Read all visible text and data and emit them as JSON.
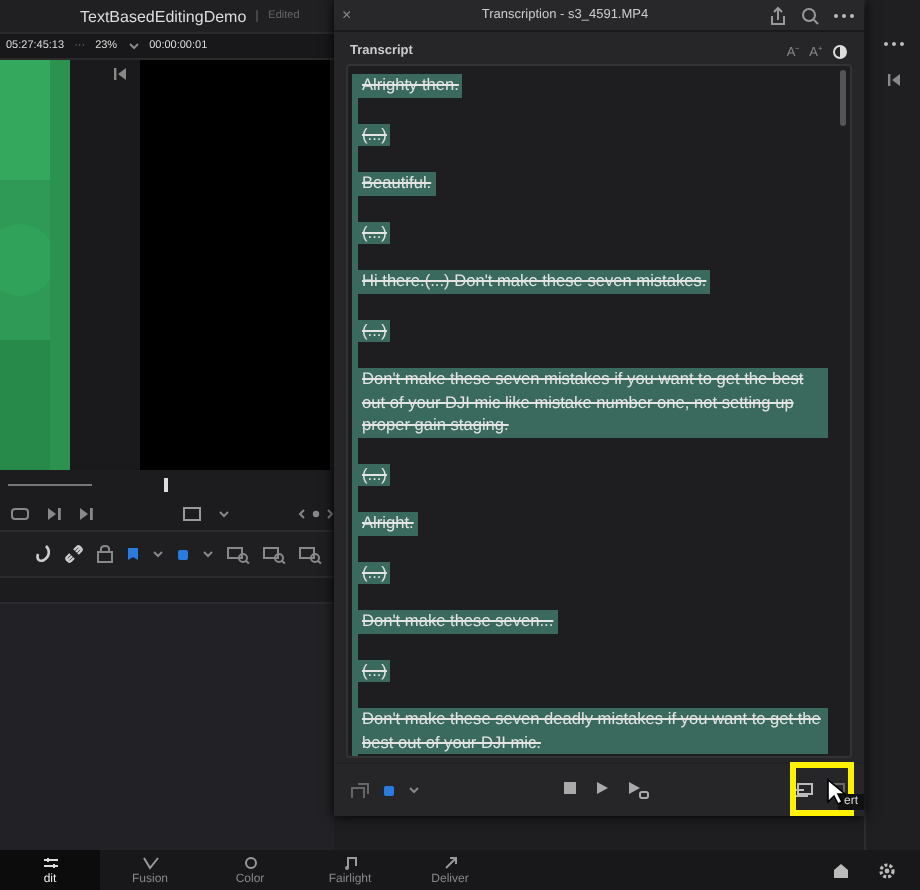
{
  "app": {
    "project_title": "TextBasedEditingDemo",
    "project_status": "Edited",
    "timecode": "05:27:45:13",
    "more": "···",
    "zoom": "23%",
    "viewer_timecode": "00:00:00:01"
  },
  "transcription_window": {
    "close": "×",
    "title": "Transcription - s3_4591.MP4",
    "section_label": "Transcript",
    "font_buttons": [
      "A⁻",
      "A⁺"
    ],
    "paragraphs": [
      {
        "text": "Alrighty then.",
        "deleted": true
      },
      {
        "text": "(...)",
        "deleted": true
      },
      {
        "text": "Beautiful.",
        "deleted": true
      },
      {
        "text": "(...)",
        "deleted": true
      },
      {
        "text": "Hi there.(...) Don't make these seven mistakes.",
        "deleted": true
      },
      {
        "text": "(...)",
        "deleted": true
      },
      {
        "text": "Don't make these seven mistakes if you want to get the best out of your DJI mic like mistake number one, not setting up proper gain staging.",
        "deleted": true
      },
      {
        "text": "(...)",
        "deleted": true
      },
      {
        "text": "Alright.",
        "deleted": true
      },
      {
        "text": "(...)",
        "deleted": true
      },
      {
        "text": "Don't make these seven...",
        "deleted": true
      },
      {
        "text": "(...)",
        "deleted": true
      },
      {
        "text": "Don't make these seven deadly mistakes if you want to get the best out of your DJI mic.",
        "deleted": true
      }
    ],
    "tooltip": "ert"
  },
  "page_tabs": [
    {
      "label": "dit",
      "selected": true
    },
    {
      "label": "Fusion",
      "selected": false
    },
    {
      "label": "Color",
      "selected": false
    },
    {
      "label": "Fairlight",
      "selected": false
    },
    {
      "label": "Deliver",
      "selected": false
    }
  ]
}
